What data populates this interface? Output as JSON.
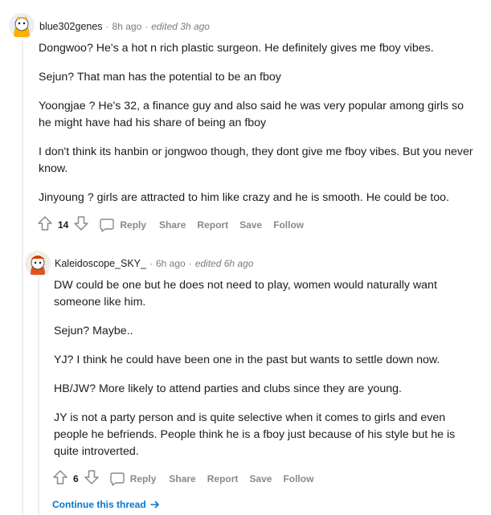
{
  "comments": [
    {
      "author": "blue302genes",
      "time": "8h ago",
      "edited": "edited 3h ago",
      "paragraphs": [
        "Dongwoo? He's a hot n rich plastic surgeon. He definitely gives me fboy vibes.",
        "Sejun? That man has the potential to be an fboy",
        "Yoongjae ? He's 32, a finance guy and also said he was very popular among girls so he might have had his share of being an fboy",
        "I don't think its hanbin or jongwoo though, they dont give me fboy vibes. But you never know.",
        "Jinyoung ? girls are attracted to him like crazy and he is smooth. He could be too."
      ],
      "score": "14",
      "actions": {
        "reply": "Reply",
        "share": "Share",
        "report": "Report",
        "save": "Save",
        "follow": "Follow"
      }
    },
    {
      "author": "Kaleidoscope_SKY_",
      "time": "6h ago",
      "edited": "edited 6h ago",
      "paragraphs": [
        "DW could be one but he does not need to play, women would naturally want someone like him.",
        "Sejun? Maybe..",
        "YJ? I think he could have been one in the past but wants to settle down now.",
        "HB/JW? More likely to attend parties and clubs since they are young.",
        "JY is not a party person and is quite selective when it comes to girls and even people he befriends. People think he is a fboy just because of his style but he is quite introverted."
      ],
      "score": "6",
      "actions": {
        "reply": "Reply",
        "share": "Share",
        "report": "Report",
        "save": "Save",
        "follow": "Follow"
      }
    }
  ],
  "continue_thread": "Continue this thread",
  "icons": [
    "upvote-icon",
    "downvote-icon",
    "speech-bubble-icon",
    "arrow-right-icon",
    "avatar-icon"
  ],
  "colors": {
    "link": "#0079d3",
    "meta": "#7c7c7c",
    "action": "#878a8c",
    "thread_line": "#edeff1"
  }
}
